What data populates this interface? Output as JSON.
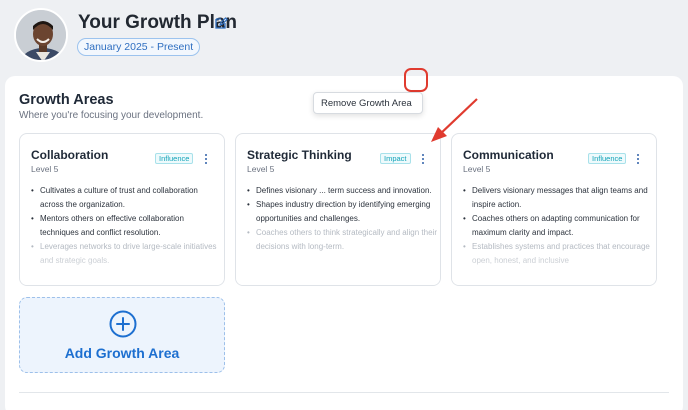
{
  "header": {
    "title": "Your Growth Plan",
    "date_range": "January 2025 - Present"
  },
  "growth_areas": {
    "title": "Growth Areas",
    "subtitle": "Where you're focusing your development.",
    "cards": [
      {
        "title": "Collaboration",
        "level": "Level 5",
        "tag": "Influence",
        "bullets": [
          "Cultivates a culture of trust and collaboration across the organization.",
          "Mentors others on effective collaboration techniques and conflict resolution.",
          "Leverages networks to drive large-scale initiatives and strategic goals."
        ]
      },
      {
        "title": "Strategic Thinking",
        "level": "Level 5",
        "tag": "Impact",
        "bullets": [
          "Defines visionary ... term success and innovation.",
          "Shapes industry direction by identifying emerging opportunities and challenges.",
          "Coaches others to think strategically and align their decisions with long-term."
        ]
      },
      {
        "title": "Communication",
        "level": "Level 5",
        "tag": "Influence",
        "bullets": [
          "Delivers visionary messages that align teams and inspire action.",
          "Coaches others on adapting communication for maximum clarity and impact.",
          "Establishes systems and practices that encourage open, honest, and inclusive"
        ]
      }
    ],
    "menu": {
      "remove_label": "Remove Growth Area"
    },
    "add_label": "Add Growth Area"
  },
  "colors": {
    "accent": "#1d6fd0",
    "tag": "#13a3b8",
    "annotation": "#e03b2f"
  }
}
